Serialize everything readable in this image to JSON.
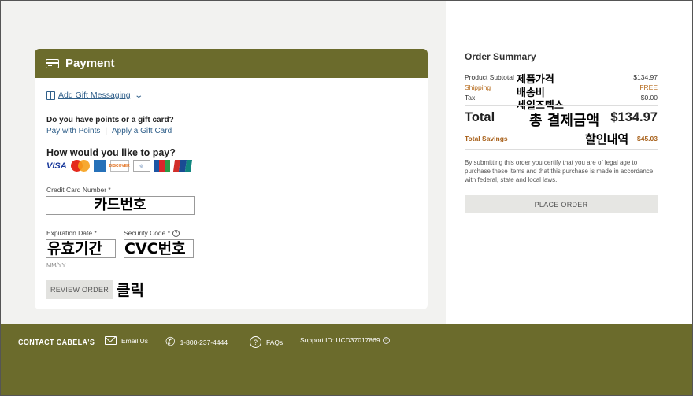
{
  "payment": {
    "title": "Payment",
    "gift_messaging": "Add Gift Messaging",
    "points_question": "Do you have points or a gift card?",
    "pay_with_points": "Pay with Points",
    "link_separator": "|",
    "apply_gift_card": "Apply a Gift Card",
    "how_to_pay": "How would you like to pay?",
    "card_brands": [
      "VISA",
      "Mastercard",
      "American Express",
      "Discover",
      "Diners Club",
      "JCB",
      "UnionPay"
    ],
    "visa_text": "VISA",
    "discover_text": "DISCOVER",
    "credit_card_label": "Credit Card Number *",
    "credit_card_value": "카드번호",
    "expiration_label": "Expiration Date *",
    "expiration_value": "유효기간",
    "expiration_hint": "MM/YY",
    "security_label": "Security Code *",
    "security_value": "CVC번호",
    "review_button": "REVIEW ORDER",
    "review_annotation": "클릭"
  },
  "order_summary": {
    "title": "Order Summary",
    "rows": [
      {
        "label": "Product Subtotal",
        "annotation": "제품가격",
        "value": "$134.97"
      },
      {
        "label": "Shipping",
        "annotation": "배송비",
        "value": "FREE"
      },
      {
        "label": "Tax",
        "annotation": "세일즈텍스",
        "value": "$0.00"
      }
    ],
    "total_label": "Total",
    "total_annotation": "총 결제금액",
    "total_value": "$134.97",
    "savings_label": "Total Savings",
    "savings_annotation": "할인내역",
    "savings_value": "$45.03",
    "legal_text": "By submitting this order you certify that you are of legal age to purchase these items and that this purchase is made in accordance with federal, state and local laws.",
    "place_order_button": "PLACE ORDER"
  },
  "footer": {
    "contact": "CONTACT CABELA'S",
    "email": "Email Us",
    "phone": "1-800-237-4444",
    "faqs": "FAQs",
    "support_id": "Support ID: UCD37017869"
  },
  "colors": {
    "brand_olive": "#6b6b2c",
    "link_blue": "#2f5f8a",
    "savings_orange": "#a8611b"
  },
  "icons": [
    "credit-card-icon",
    "gift-icon",
    "chevron-down-icon",
    "help-circle-icon",
    "mail-icon",
    "phone-icon",
    "faq-icon"
  ]
}
